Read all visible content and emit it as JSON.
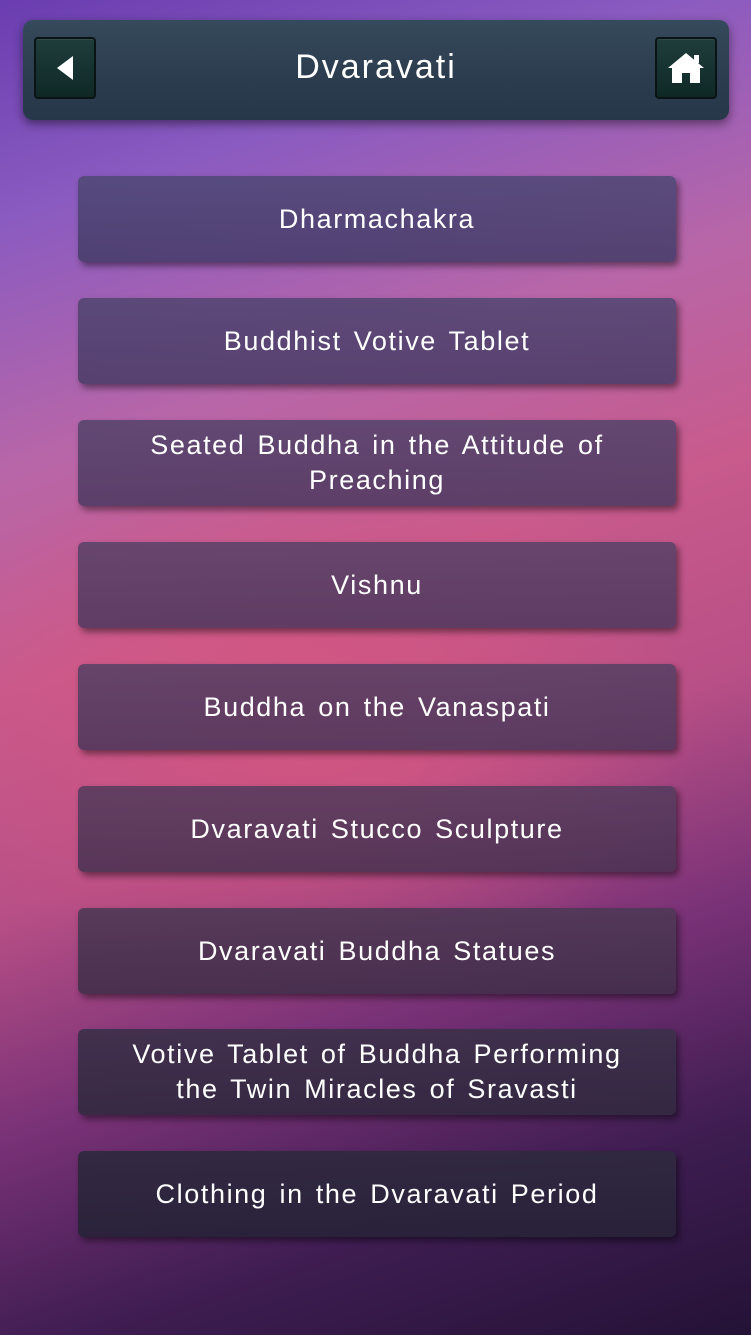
{
  "header": {
    "title": "Dvaravati",
    "back_icon": "back-triangle-icon",
    "home_icon": "home-icon"
  },
  "menu": {
    "items": [
      {
        "label": "Dharmachakra"
      },
      {
        "label": "Buddhist Votive Tablet"
      },
      {
        "label": "Seated Buddha in the Attitude of Preaching"
      },
      {
        "label": "Vishnu"
      },
      {
        "label": "Buddha on the Vanaspati"
      },
      {
        "label": "Dvaravati Stucco Sculpture"
      },
      {
        "label": "Dvaravati Buddha Statues"
      },
      {
        "label": "Votive Tablet of Buddha Performing the Twin Miracles of Sravasti"
      },
      {
        "label": "Clothing in the Dvaravati Period"
      }
    ]
  },
  "colors": {
    "header_bg": "#2c3d4f",
    "icon_button_bg": "#163230",
    "text": "#ffffff",
    "background_top": "#6a3db0",
    "background_mid": "#c85a8c",
    "background_bottom": "#241236"
  }
}
